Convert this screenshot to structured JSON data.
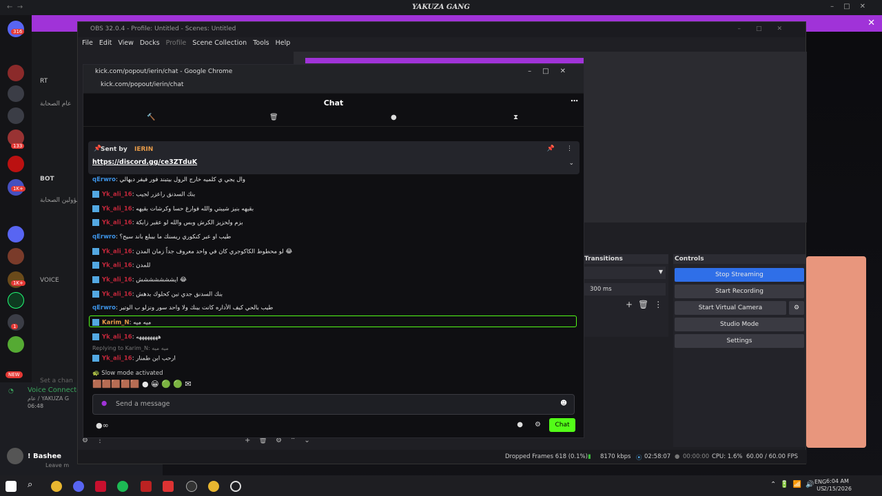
{
  "discord": {
    "title": "YAKUZA GANG",
    "server_badges": [
      "316",
      "133",
      "1K+",
      "1K+",
      "1",
      "1"
    ],
    "new_badge": "NEW",
    "channels": [
      "عام الصحابة",
      "مسؤولين الصحابة",
      "VOICE",
      "BOT",
      "RT"
    ],
    "voice_connected": "Voice Connected",
    "voice_sub": "عام / YAKUZA G",
    "timer": "06:48",
    "user_name": "! Bashee",
    "user_status": "Leave m",
    "set_status": "Set a chan"
  },
  "obs": {
    "title": "OBS 32.0.4 - Profile: Untitled - Scenes: Untitled",
    "menu": [
      "File",
      "Edit",
      "View",
      "Docks",
      "Profile",
      "Scene Collection",
      "Tools",
      "Help"
    ],
    "transitions_label": "Transitions",
    "duration": "300 ms",
    "controls_label": "Controls",
    "controls": [
      "Stop Streaming",
      "Start Recording",
      "Start Virtual Camera",
      "Studio Mode",
      "Settings"
    ],
    "status": {
      "dropped": "Dropped Frames 618 (0.1%)",
      "bitrate": "8170 kbps",
      "stream_time": "02:58:07",
      "rec_time": "00:00:00",
      "cpu": "CPU: 1.6%",
      "fps": "60.00 / 60.00 FPS"
    }
  },
  "chrome": {
    "title": "kick.com/popout/ierin/chat - Google Chrome",
    "url": "kick.com/popout/ierin/chat"
  },
  "chat": {
    "header": "Chat",
    "pinned_label": "Sent by",
    "pinned_user": "IERIN",
    "pinned_link": "https://discord.gg/ce3ZTduK",
    "messages": [
      {
        "user": "qErwro",
        "text": "وال يجي ي كلميه خارج الرول بيتبند فور فيفر ديهالي",
        "style": "ub"
      },
      {
        "user": "Yk_ali_16",
        "text": "بنك السدنق راعزر لجيب",
        "style": "un"
      },
      {
        "user": "Yk_ali_16",
        "text": "بقيهه بنيز شيبتي والله فوارغ حسا وكرشات بقيهه",
        "style": "un"
      },
      {
        "user": "Yk_ali_16",
        "text": "بزم ولحزيز الكرش وبس والله لو عقبر زابكة",
        "style": "un"
      },
      {
        "user": "qErwro",
        "text": "طيب او عبر كنكوري ريسنك ما بيبلع باند سيح؟",
        "style": "ub"
      },
      {
        "user": "Yk_ali_16",
        "text": "لو محطوط الكاكوجري كان في واحد معروف جداً زمان المدن 😂",
        "style": "un"
      },
      {
        "user": "Yk_ali_16",
        "text": "للمدن",
        "style": "un"
      },
      {
        "user": "Yk_ali_16",
        "text": "ايششششششش 😂",
        "style": "un"
      },
      {
        "user": "Yk_ali_16",
        "text": "بنك السدنق جدي تبن كحلوك بدهش",
        "style": "un"
      },
      {
        "user": "qErwro",
        "text": "طيب بالحي كيف الأداره كانت بينك ولا واحد سور ونزلو ب الوتير",
        "style": "ub"
      },
      {
        "user": "Karim_N",
        "text": "ميه ميه",
        "style": "ug"
      },
      {
        "user": "Yk_ali_16",
        "text": "ههههههههه",
        "style": "un"
      },
      {
        "user": "Yk_ali_16",
        "text": "ارحب ابن طمنار",
        "style": "un"
      }
    ],
    "reply_to": "Replying to Karim_N: ميه ميه",
    "slow_mode": "Slow mode activated",
    "input_placeholder": "Send a message",
    "send_label": "Chat"
  },
  "taskbar": {
    "lang": "ENG",
    "region": "US",
    "time": "6:04 AM",
    "date": "2/15/2026"
  },
  "colors": {
    "kick_green": "#53fc18",
    "obs_blue": "#2f6fe8",
    "discord_purple": "#a033d8"
  }
}
